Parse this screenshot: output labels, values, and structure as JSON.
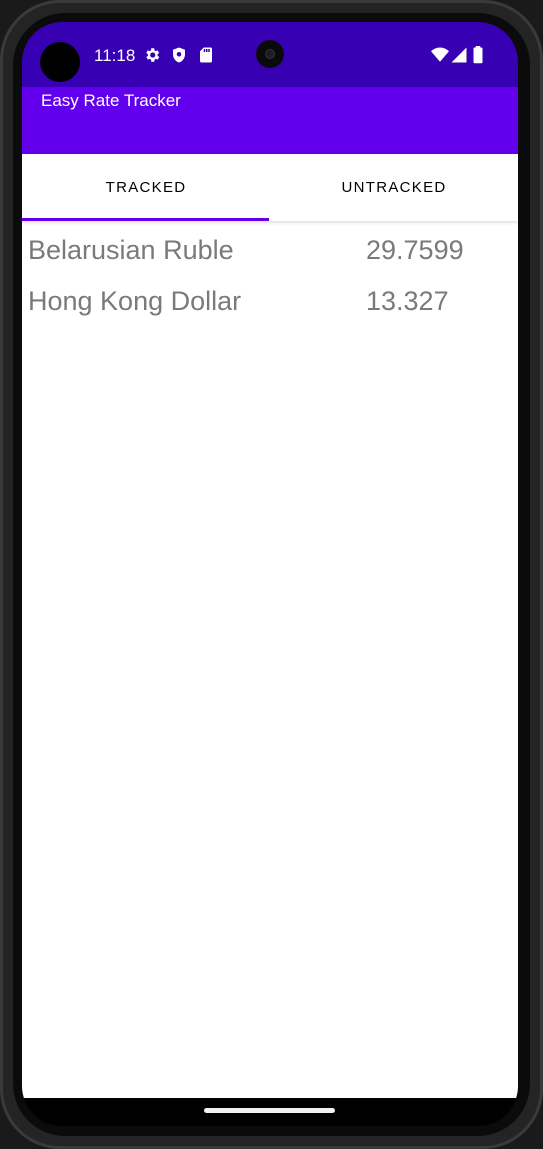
{
  "status_bar": {
    "time": "11:18",
    "left_icons": [
      "gear-icon",
      "shield-icon",
      "sd-card-icon"
    ],
    "right_icons": [
      "wifi-icon",
      "cell-signal-icon",
      "battery-icon"
    ],
    "color": "#3700b3"
  },
  "app_bar": {
    "title": "Easy Rate Tracker",
    "color": "#6200ee"
  },
  "tabs": [
    {
      "label": "TRACKED",
      "selected": true
    },
    {
      "label": "UNTRACKED",
      "selected": false
    }
  ],
  "rates": [
    {
      "currency": "Belarusian Ruble",
      "value": "29.7599"
    },
    {
      "currency": "Hong Kong Dollar",
      "value": "13.327"
    }
  ],
  "accent_color": "#6200ee",
  "text_color": "#7a7a7a"
}
